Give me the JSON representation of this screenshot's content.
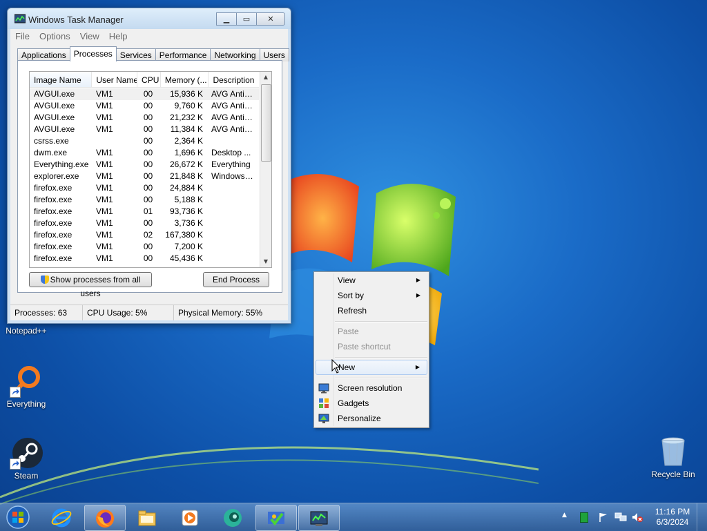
{
  "desktop": {
    "icons": [
      {
        "label": "Notepad++"
      },
      {
        "label": "Everything"
      },
      {
        "label": "Steam"
      },
      {
        "label": "Recycle Bin"
      }
    ]
  },
  "task_manager": {
    "title": "Windows Task Manager",
    "menu": [
      "File",
      "Options",
      "View",
      "Help"
    ],
    "tabs": [
      "Applications",
      "Processes",
      "Services",
      "Performance",
      "Networking",
      "Users"
    ],
    "active_tab": "Processes",
    "columns": [
      "Image Name",
      "User Name",
      "CPU",
      "Memory (...",
      "Description"
    ],
    "rows": [
      {
        "name": "AVGUI.exe",
        "user": "VM1",
        "cpu": "00",
        "mem": "15,936 K",
        "desc": "AVG Antiv..."
      },
      {
        "name": "AVGUI.exe",
        "user": "VM1",
        "cpu": "00",
        "mem": "9,760 K",
        "desc": "AVG Antiv..."
      },
      {
        "name": "AVGUI.exe",
        "user": "VM1",
        "cpu": "00",
        "mem": "21,232 K",
        "desc": "AVG Antiv..."
      },
      {
        "name": "AVGUI.exe",
        "user": "VM1",
        "cpu": "00",
        "mem": "11,384 K",
        "desc": "AVG Antiv..."
      },
      {
        "name": "csrss.exe",
        "user": "",
        "cpu": "00",
        "mem": "2,364 K",
        "desc": ""
      },
      {
        "name": "dwm.exe",
        "user": "VM1",
        "cpu": "00",
        "mem": "1,696 K",
        "desc": "Desktop ..."
      },
      {
        "name": "Everything.exe",
        "user": "VM1",
        "cpu": "00",
        "mem": "26,672 K",
        "desc": "Everything"
      },
      {
        "name": "explorer.exe",
        "user": "VM1",
        "cpu": "00",
        "mem": "21,848 K",
        "desc": "Windows ..."
      },
      {
        "name": "firefox.exe",
        "user": "VM1",
        "cpu": "00",
        "mem": "24,884 K",
        "desc": ""
      },
      {
        "name": "firefox.exe",
        "user": "VM1",
        "cpu": "00",
        "mem": "5,188 K",
        "desc": ""
      },
      {
        "name": "firefox.exe",
        "user": "VM1",
        "cpu": "01",
        "mem": "93,736 K",
        "desc": ""
      },
      {
        "name": "firefox.exe",
        "user": "VM1",
        "cpu": "00",
        "mem": "3,736 K",
        "desc": ""
      },
      {
        "name": "firefox.exe",
        "user": "VM1",
        "cpu": "02",
        "mem": "167,380 K",
        "desc": ""
      },
      {
        "name": "firefox.exe",
        "user": "VM1",
        "cpu": "00",
        "mem": "7,200 K",
        "desc": ""
      },
      {
        "name": "firefox.exe",
        "user": "VM1",
        "cpu": "00",
        "mem": "45,436 K",
        "desc": ""
      }
    ],
    "show_all_label": "Show processes from all users",
    "end_process_label": "End Process",
    "status": {
      "processes": "Processes: 63",
      "cpu": "CPU Usage: 5%",
      "memory": "Physical Memory: 55%"
    }
  },
  "context_menu": {
    "items": [
      {
        "label": "View",
        "submenu": true,
        "disabled": false
      },
      {
        "label": "Sort by",
        "submenu": true,
        "disabled": false
      },
      {
        "label": "Refresh",
        "submenu": false,
        "disabled": false
      },
      {
        "label": "Paste",
        "submenu": false,
        "disabled": true
      },
      {
        "label": "Paste shortcut",
        "submenu": false,
        "disabled": true
      },
      {
        "label": "New",
        "submenu": true,
        "disabled": false,
        "highlighted": true
      },
      {
        "label": "Screen resolution",
        "icon": "monitor-icon"
      },
      {
        "label": "Gadgets",
        "icon": "gadgets-icon"
      },
      {
        "label": "Personalize",
        "icon": "personalize-icon"
      }
    ]
  },
  "taskbar": {
    "clock_time": "11:16 PM",
    "clock_date": "6/3/2024",
    "pinned": [
      "internet-explorer-icon",
      "firefox-icon",
      "file-explorer-icon",
      "media-player-icon",
      "app-icon",
      "avg-icon",
      "task-manager-icon"
    ]
  },
  "colors": {
    "desktop_blue": "#1a6bc7",
    "menu_bg": "#f0f0f0",
    "highlight_border": "#aecbf0"
  }
}
